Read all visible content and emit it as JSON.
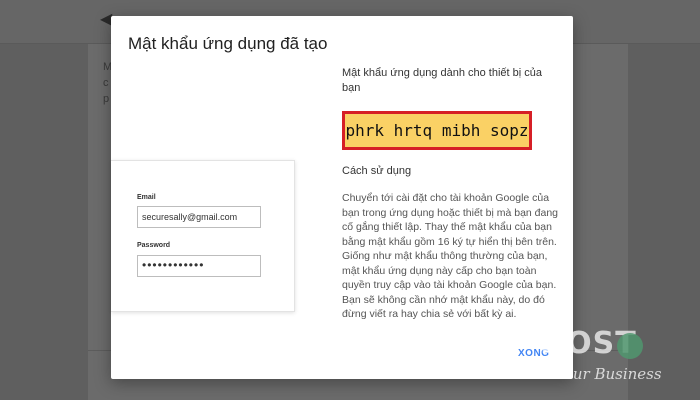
{
  "dialog": {
    "title": "Mật khẩu ứng dụng đã tạo",
    "password_heading": "Mật khẩu ứng dụng dành cho thiết bị của bạn",
    "password_value": "phrk hrtq mibh sopz",
    "usage_heading": "Cách sử dụng",
    "usage_paragraph_1": "Chuyển tới cài đặt cho tài khoản Google của bạn trong ứng dụng hoặc thiết bị mà bạn đang cố gắng thiết lập. Thay thế mật khẩu của bạn bằng mật khẩu gồm 16 ký tự hiển thị bên trên.",
    "usage_paragraph_2": "Giống như mật khẩu thông thường của bạn, mật khẩu ứng dụng này cấp cho bạn toàn quyền truy cập vào tài khoản Google của bạn. Bạn sẽ không cần nhớ mật khẩu này, do đó đừng viết ra hay chia sẻ với bất kỳ ai.",
    "done_label": "XONG"
  },
  "illustration": {
    "email_label": "Email",
    "email_value": "securesally@gmail.com",
    "password_label": "Password",
    "password_value": "••••••••••••"
  },
  "background": {
    "line1": "M",
    "line2": "c",
    "line3": "p"
  },
  "watermark": {
    "brand": "HOST",
    "tagline": "Start Your Business"
  },
  "colors": {
    "accent": "#4285f4",
    "highlight": "#fad165",
    "highlight_border": "#d61f26"
  }
}
